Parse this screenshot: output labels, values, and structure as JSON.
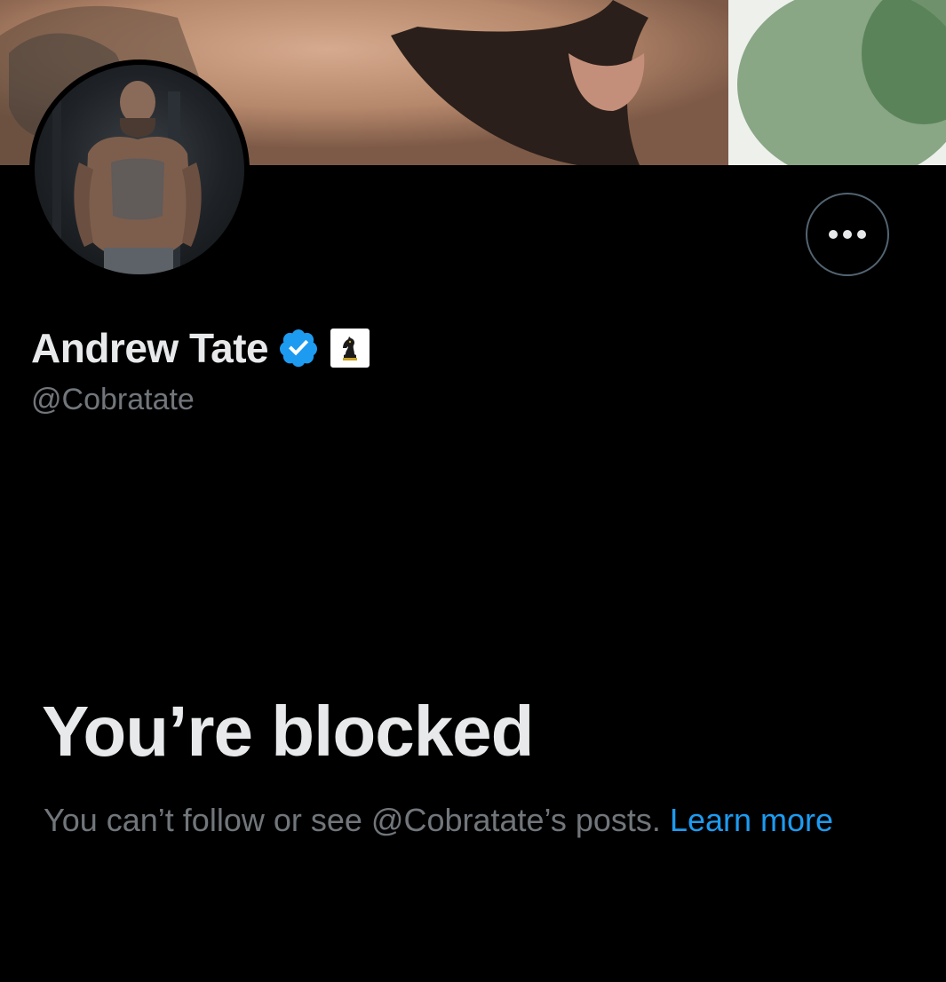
{
  "profile": {
    "display_name": "Andrew Tate",
    "handle": "@Cobratate",
    "verified_icon": "verified-badge-icon",
    "affiliate_icon": "chess-knight-icon"
  },
  "actions": {
    "more_icon": "more-horizontal-icon"
  },
  "blocked": {
    "title": "You’re blocked",
    "description": "You can’t follow or see @Cobratate’s posts.",
    "link_label": "Learn more"
  },
  "colors": {
    "background": "#000000",
    "primary_text": "#e7e9ea",
    "secondary_text": "#71767b",
    "link": "#1d9bf0",
    "verified": "#1d9bf0",
    "border": "#536471"
  }
}
